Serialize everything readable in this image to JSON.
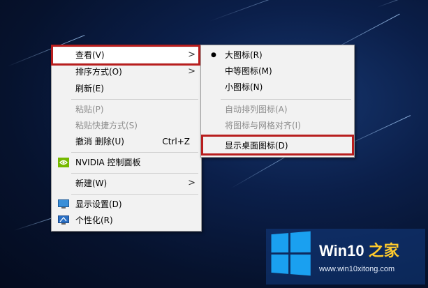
{
  "desktop": {
    "background": "starry-night-blue"
  },
  "main_menu": {
    "items": [
      {
        "label": "查看(V)",
        "has_submenu": true,
        "highlighted": true
      },
      {
        "label": "排序方式(O)",
        "has_submenu": true
      },
      {
        "label": "刷新(E)"
      },
      {
        "label": "粘贴(P)",
        "disabled": true
      },
      {
        "label": "粘贴快捷方式(S)",
        "disabled": true
      },
      {
        "label": "撤消 删除(U)",
        "shortcut": "Ctrl+Z"
      },
      {
        "label": "NVIDIA 控制面板",
        "icon": "nvidia-icon"
      },
      {
        "label": "新建(W)",
        "has_submenu": true
      },
      {
        "label": "显示设置(D)",
        "icon": "display-settings-icon"
      },
      {
        "label": "个性化(R)",
        "icon": "personalize-icon"
      }
    ]
  },
  "view_submenu": {
    "items": [
      {
        "label": "大图标(R)",
        "selected": true
      },
      {
        "label": "中等图标(M)"
      },
      {
        "label": "小图标(N)"
      },
      {
        "label": "自动排列图标(A)",
        "disabled": true
      },
      {
        "label": "将图标与网格对齐(I)",
        "disabled": true
      },
      {
        "label": "显示桌面图标(D)"
      }
    ]
  },
  "annotation_color": "#b81e1e",
  "watermark": {
    "title_main": "Win10",
    "title_accent": "之家",
    "url": "www.win10xitong.com"
  }
}
